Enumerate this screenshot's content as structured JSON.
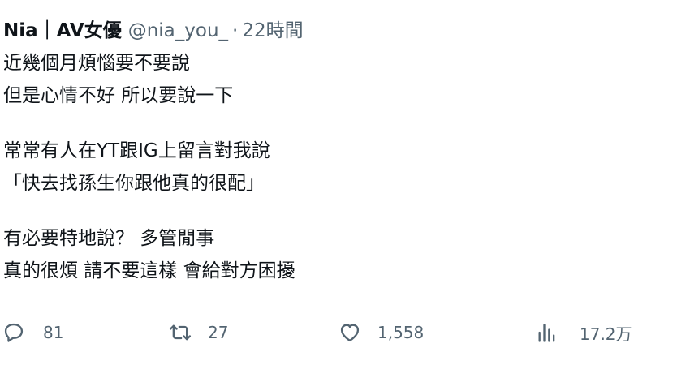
{
  "tweet": {
    "display_name": "Nia｜AV女優",
    "handle": "@nia_you_",
    "separator": "·",
    "time": "22時間",
    "lines": [
      "近幾個月煩惱要不要說",
      "但是心情不好 所以要說一下",
      "",
      "常常有人在YT跟IG上留言對我說",
      "「快去找孫生你跟他真的很配」",
      "",
      "有必要特地說？ 多管閒事",
      "真的很煩 請不要這樣 會給對方困擾"
    ]
  },
  "actions": {
    "reply": {
      "icon": "reply-icon",
      "count": "81"
    },
    "retweet": {
      "icon": "retweet-icon",
      "count": "27"
    },
    "like": {
      "icon": "heart-icon",
      "count": "1,558"
    },
    "views": {
      "icon": "views-icon",
      "count": "17.2万"
    }
  },
  "colors": {
    "text": "#0f1419",
    "secondary": "#536471",
    "background": "#ffffff"
  }
}
